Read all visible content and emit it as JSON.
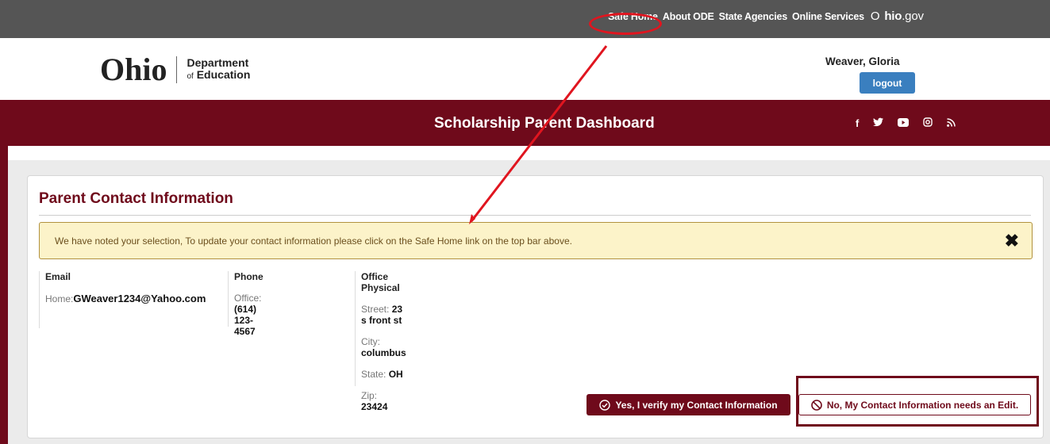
{
  "topbar": {
    "links": [
      "Safe Home",
      "About ODE",
      "State Agencies",
      "Online Services"
    ],
    "ohio_gov": {
      "prefix": "O",
      "strong": "hio",
      "suffix": ".gov"
    }
  },
  "header": {
    "logo": {
      "ohio": "Ohio",
      "dept_line1": "Department",
      "dept_of": "of",
      "dept_line2": "Education"
    },
    "user_name": "Weaver, Gloria",
    "logout_label": "logout"
  },
  "banner": {
    "title": "Scholarship Parent Dashboard",
    "social_icons": [
      "facebook-icon",
      "twitter-icon",
      "youtube-icon",
      "instagram-icon",
      "rss-icon"
    ]
  },
  "panel": {
    "title": "Parent Contact Information",
    "alert_message": "We have noted your selection, To update your contact information please click on the Safe Home link on the top bar above.",
    "alert_close": "✖",
    "email": {
      "header": "Email",
      "label": "Home:",
      "value": "GWeaver1234@Yahoo.com"
    },
    "phone": {
      "header": "Phone",
      "label": "Office:",
      "value": "(614) 123-4567"
    },
    "address": {
      "header": "Office Physical",
      "street_label": "Street:",
      "street": "23 s front st",
      "city_label": "City:",
      "city": "columbus",
      "state_label": "State:",
      "state": "OH",
      "zip_label": "Zip:",
      "zip": "23424"
    },
    "verify_button": "Yes, I verify my Contact Information",
    "edit_button": "No, My Contact Information needs an Edit."
  },
  "colors": {
    "brand_maroon": "#6f0a1b",
    "topbar_gray": "#555555",
    "alert_bg": "#fcf3c9",
    "logout_blue": "#3a7fbf",
    "annotation_red": "#e0151f"
  }
}
